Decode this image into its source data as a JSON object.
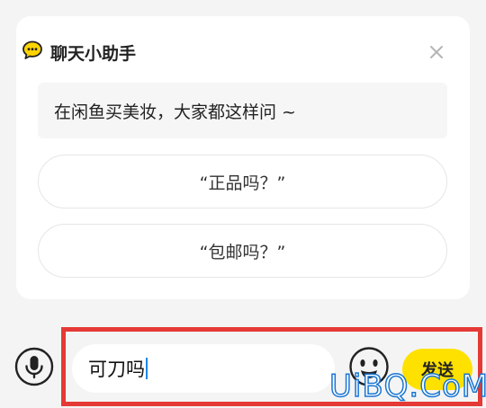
{
  "assistant_card": {
    "title": "聊天小助手",
    "title_icon": "chat-bubble-icon",
    "close_icon": "close-icon",
    "prompt": "在闲鱼买美妆，大家都这样问 ~",
    "suggestions": [
      {
        "label": "“正品吗？”"
      },
      {
        "label": "“包邮吗？”"
      }
    ]
  },
  "composer": {
    "mic_icon": "microphone-icon",
    "input_value": "可刀吗",
    "emoji_icon": "emoji-icon",
    "send_label": "发送"
  },
  "watermark": "UiBQ.CoM",
  "colors": {
    "accent": "#ffe100",
    "highlight_border": "#e53935",
    "caret": "#1e88e5",
    "watermark": "#1976d2"
  }
}
